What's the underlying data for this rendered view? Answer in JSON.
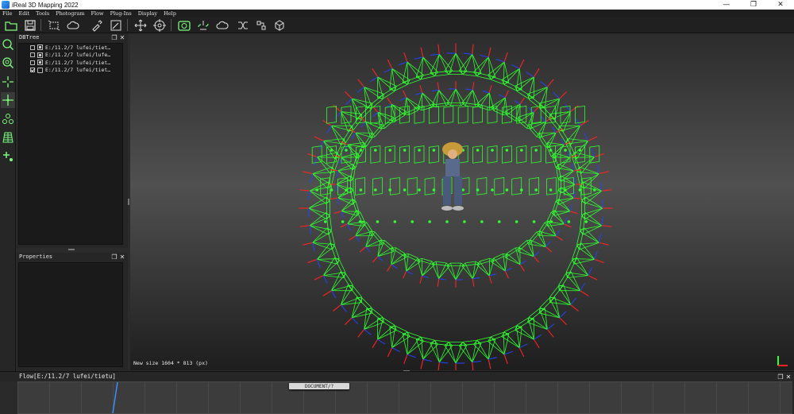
{
  "window": {
    "title": "iReal 3D Mapping 2022",
    "minimize": "—",
    "maximize": "❐",
    "close": "✕"
  },
  "menu": [
    "File",
    "Edit",
    "Tools",
    "Photogram",
    "Flow",
    "Plug-Ins",
    "Display",
    "Help"
  ],
  "dbtree": {
    "title": "DBTree",
    "rows": [
      {
        "label": "E:/11.2/7 lufei/tiet…",
        "checked": false,
        "icon": "camera-node-icon"
      },
      {
        "label": "E:/11.2/7 lufei/lufe…",
        "checked": false,
        "icon": "camera-node-icon"
      },
      {
        "label": "E:/11.2/7 lufei/tiet…",
        "checked": false,
        "icon": "camera-node-icon"
      },
      {
        "label": "E:/11.2/7 lufei/tiet…",
        "checked": true,
        "icon": "folder-node-icon"
      }
    ]
  },
  "properties": {
    "title": "Properties"
  },
  "viewport": {
    "status": "New size 1604 * 813 (px)",
    "colors": {
      "camera": "#2eff2e",
      "axis_x": "#ff2222",
      "axis_z": "#2244ff"
    }
  },
  "flow": {
    "title": "Flow[E:/11.2/7 lufei/tietu]",
    "node_label": "DOCUMENT/?"
  },
  "icons": {
    "toolbar": [
      "new-project-icon",
      "save-icon",
      "crop-icon",
      "cloud-icon",
      "brush-icon",
      "edit-icon",
      "pan-icon",
      "target-icon",
      "green-camera-icon",
      "cloud-sync-icon",
      "cloud-upload-icon",
      "shuffle-icon",
      "cube-icon",
      "export-icon"
    ],
    "left": [
      "zoom-icon",
      "zoom-fit-icon",
      "crosshair-icon",
      "crosshair-active-icon",
      "connect-icon",
      "grid-icon",
      "add-point-icon"
    ]
  }
}
